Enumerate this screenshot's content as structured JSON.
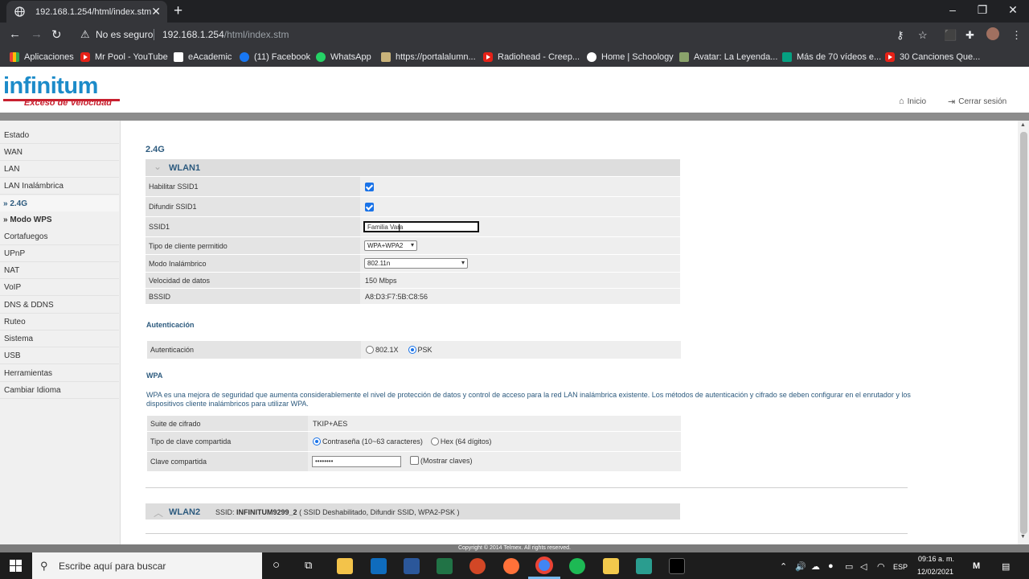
{
  "browser": {
    "tab_title": "192.168.1.254/html/index.stm",
    "new_tab": "+",
    "not_secure": "No es seguro",
    "url_host": "192.168.1.254",
    "url_path": "/html/index.stm",
    "bookmarks": [
      "Aplicaciones",
      "Mr Pool - YouTube",
      "eAcademic",
      "(11) Facebook",
      "WhatsApp",
      "https://portalalumn...",
      "Radiohead - Creep...",
      "Home | Schoology",
      "Avatar: La Leyenda...",
      "Más de 70 vídeos e...",
      "30 Canciones Que..."
    ]
  },
  "header": {
    "logo_text": "infinitum",
    "logo_tagline": "Exceso de Velocidad",
    "home_link": "Inicio",
    "logout_link": "Cerrar sesión"
  },
  "sidebar": {
    "items": [
      "Estado",
      "WAN",
      "LAN",
      "LAN Inalámbrica",
      "» 2.4G",
      "» Modo WPS",
      "Cortafuegos",
      "UPnP",
      "NAT",
      "VoIP",
      "DNS & DDNS",
      "Ruteo",
      "Sistema",
      "USB",
      "Herramientas",
      "Cambiar Idioma"
    ]
  },
  "main": {
    "band_title": "2.4G",
    "wlan1": {
      "title": "WLAN1",
      "enable_ssid_label": "Habilitar SSID1",
      "broadcast_ssid_label": "Difundir SSID1",
      "ssid_label": "SSID1",
      "ssid_value": "Familia Vara",
      "client_type_label": "Tipo de cliente permitido",
      "client_type_value": "WPA+WPA2",
      "mode_label": "Modo Inalámbrico",
      "mode_value": "802.11n",
      "rate_label": "Velocidad de datos",
      "rate_value": "150 Mbps",
      "bssid_label": "BSSID",
      "bssid_value": "A8:D3:F7:5B:C8:56"
    },
    "auth": {
      "section_title": "Autenticación",
      "label": "Autenticación",
      "option_8021x": "802.1X",
      "option_psk": "PSK"
    },
    "wpa": {
      "section_title": "WPA",
      "description": "WPA es una mejora de seguridad que aumenta considerablemente el nivel de protección de datos y control de acceso para la red LAN inalámbrica existente. Los métodos de autenticación y cifrado se deben configurar en el enrutador y los dispositivos cliente inalámbricos para utilizar WPA.",
      "cipher_label": "Suite de cifrado",
      "cipher_value": "TKIP+AES",
      "key_type_label": "Tipo de clave compartida",
      "key_type_password": "Contraseña (10~63 caracteres)",
      "key_type_hex": "Hex (64 dígitos)",
      "shared_key_label": "Clave compartida",
      "shared_key_value": "••••••••",
      "show_keys": "(Mostrar claves)"
    },
    "wlan2": {
      "title": "WLAN2",
      "ssid_prefix": "SSID:",
      "ssid_name": "INFINITUM9299_2",
      "status": "( SSID Deshabilitado, Difundir SSID, WPA2-PSK )"
    },
    "copyright": "Copyright © 2014 Telmex. All rights reserved."
  },
  "taskbar": {
    "search_placeholder": "Escribe aquí para buscar",
    "lang": "ESP",
    "time": "09:16 a. m.",
    "date": "12/02/2021"
  },
  "colors": {
    "accent_blue": "#1c8bc9",
    "label_blue": "#2c5a7e",
    "brand_red": "#c8202f"
  }
}
